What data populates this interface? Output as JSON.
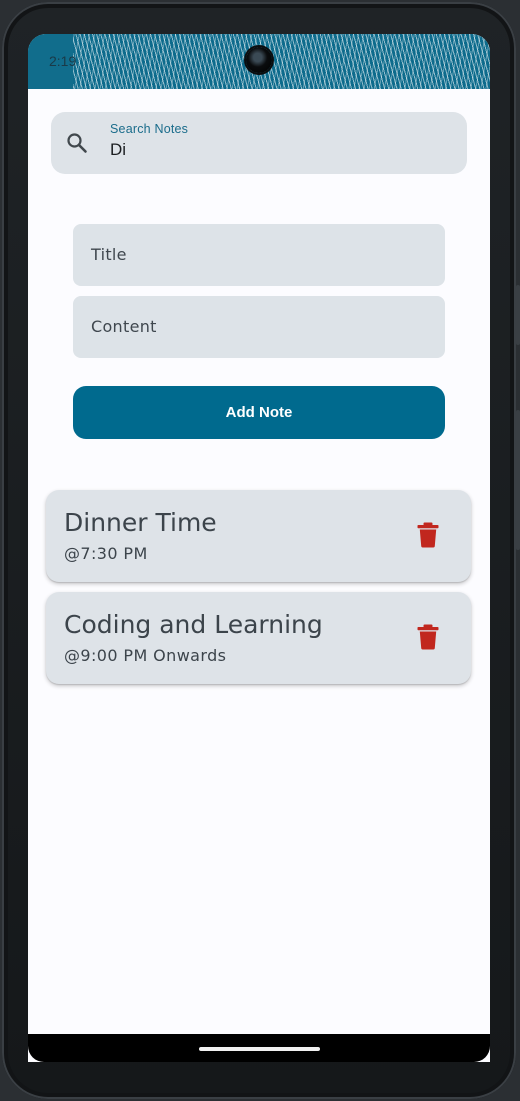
{
  "status_bar": {
    "time": "2:19"
  },
  "search": {
    "label": "Search Notes",
    "value": "Di"
  },
  "form": {
    "title_placeholder": "Title",
    "content_placeholder": "Content",
    "add_button_label": "Add Note"
  },
  "notes": [
    {
      "title": "Dinner Time",
      "content": "@7:30 PM"
    },
    {
      "title": "Coding and Learning",
      "content": "@9:00 PM Onwards"
    }
  ],
  "colors": {
    "primary": "#006a8e",
    "delete_icon": "#c1271e",
    "surface_variant": "#dee3e8",
    "background": "#fcfcff"
  },
  "icons": {
    "search": "search-icon",
    "delete": "trash-icon"
  }
}
